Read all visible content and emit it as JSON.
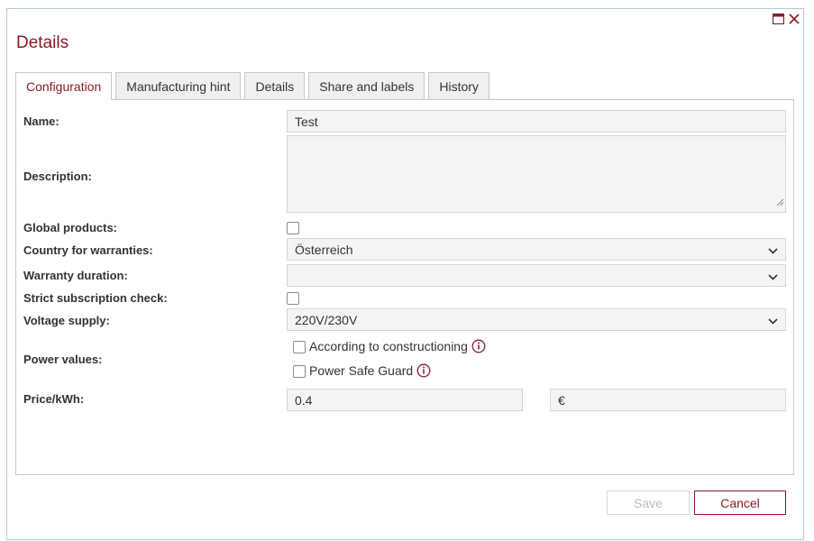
{
  "dialog": {
    "title": "Details",
    "accent_color": "#8b1b2a"
  },
  "tabs": [
    {
      "label": "Configuration",
      "active": true
    },
    {
      "label": "Manufacturing hint",
      "active": false
    },
    {
      "label": "Details",
      "active": false
    },
    {
      "label": "Share and labels",
      "active": false
    },
    {
      "label": "History",
      "active": false
    }
  ],
  "form": {
    "name": {
      "label": "Name:",
      "value": "Test"
    },
    "description": {
      "label": "Description:",
      "value": ""
    },
    "global_products": {
      "label": "Global products:",
      "checked": false
    },
    "country": {
      "label": "Country for warranties:",
      "value": "Österreich"
    },
    "warranty": {
      "label": "Warranty duration:",
      "value": ""
    },
    "strict_check": {
      "label": "Strict subscription check:",
      "checked": false
    },
    "voltage": {
      "label": "Voltage supply:",
      "value": "220V/230V"
    },
    "power_values": {
      "label": "Power values:",
      "options": [
        {
          "label": "According to constructioning",
          "checked": false,
          "icon": "info-icon"
        },
        {
          "label": "Power Safe Guard",
          "checked": false,
          "icon": "info-icon"
        }
      ]
    },
    "price": {
      "label": "Price/kWh:",
      "value": "0.4",
      "currency": "€"
    }
  },
  "buttons": {
    "save": "Save",
    "cancel": "Cancel"
  }
}
